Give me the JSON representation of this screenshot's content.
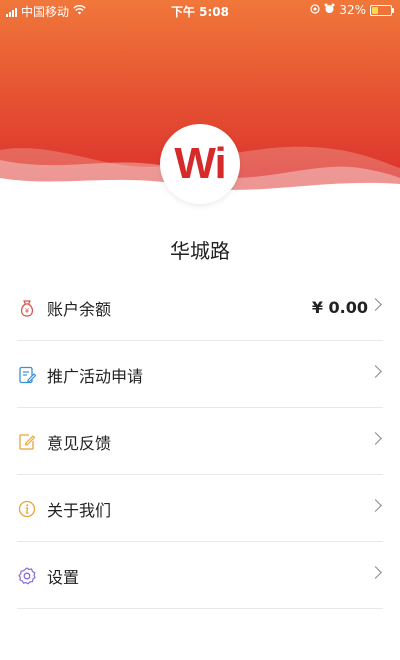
{
  "status": {
    "carrier": "中国移动",
    "time": "下午 5:08",
    "battery": "32%",
    "battery_level": 0.32
  },
  "header": {
    "logo_text": "Wi",
    "store_name": "华城路"
  },
  "menu": {
    "items": [
      {
        "label": "账户余额",
        "value": "¥ 0.00",
        "icon": "money-bag-icon"
      },
      {
        "label": "推广活动申请",
        "icon": "document-edit-icon"
      },
      {
        "label": "意见反馈",
        "icon": "feedback-edit-icon"
      },
      {
        "label": "关于我们",
        "icon": "info-icon"
      },
      {
        "label": "设置",
        "icon": "gear-icon"
      }
    ]
  },
  "colors": {
    "header_top": "#f0773a",
    "header_bottom": "#d9282a",
    "logo_red": "#d62a2a"
  }
}
